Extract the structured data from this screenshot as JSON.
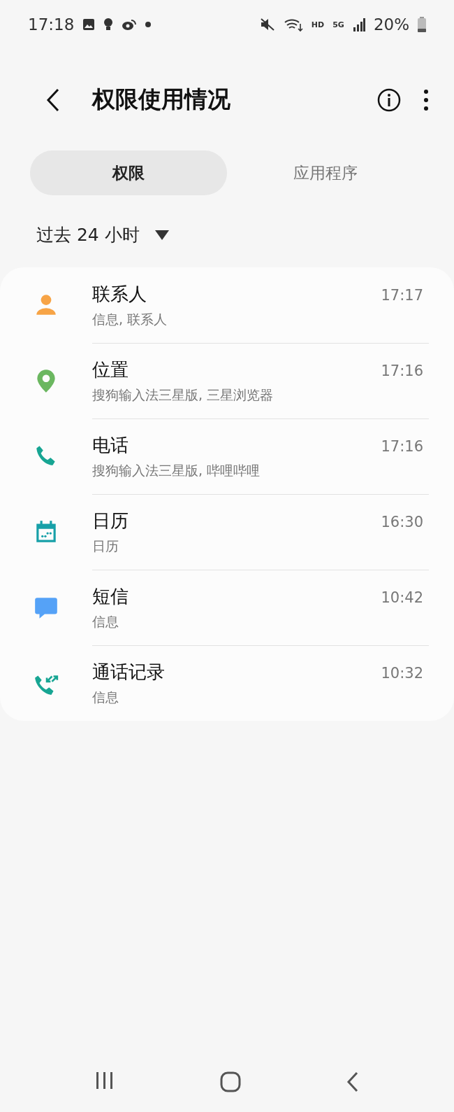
{
  "status_bar": {
    "time": "17:18",
    "hd": "HD",
    "network": "5G",
    "battery": "20%"
  },
  "header": {
    "title": "权限使用情况"
  },
  "tabs": [
    {
      "label": "权限",
      "selected": true
    },
    {
      "label": "应用程序",
      "selected": false
    }
  ],
  "filter": {
    "label": "过去 24 小时"
  },
  "permissions": [
    {
      "kind": "contacts",
      "name": "联系人",
      "apps": "信息, 联系人",
      "time": "17:17"
    },
    {
      "kind": "location",
      "name": "位置",
      "apps": "搜狗输入法三星版, 三星浏览器",
      "time": "17:16"
    },
    {
      "kind": "phone",
      "name": "电话",
      "apps": "搜狗输入法三星版, 哔哩哔哩",
      "time": "17:16"
    },
    {
      "kind": "calendar",
      "name": "日历",
      "apps": "日历",
      "time": "16:30"
    },
    {
      "kind": "sms",
      "name": "短信",
      "apps": "信息",
      "time": "10:42"
    },
    {
      "kind": "call_log",
      "name": "通话记录",
      "apps": "信息",
      "time": "10:32"
    }
  ]
}
